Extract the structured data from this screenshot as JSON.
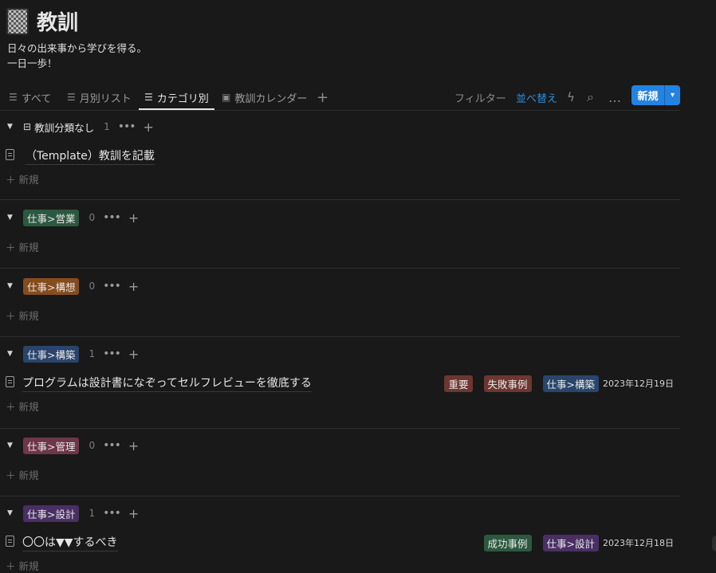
{
  "page": {
    "title": "教訓",
    "desc1": "日々の出来事から学びを得る。",
    "desc2": "一日一歩！"
  },
  "tabs": [
    {
      "label": "すべて",
      "icon": "list-icon"
    },
    {
      "label": "月別リスト",
      "icon": "list-icon"
    },
    {
      "label": "カテゴリ別",
      "icon": "list-icon"
    },
    {
      "label": "教訓カレンダー",
      "icon": "calendar-icon"
    }
  ],
  "toolbar": {
    "add_view": "+",
    "filter": "フィルター",
    "sort": "並べ替え",
    "automation": "ϟ",
    "search": "⌕",
    "more": "…",
    "new": "新規",
    "new_dropdown": "▾"
  },
  "groups": [
    {
      "name": "教訓分類なし",
      "count": "1",
      "rows": [
        {
          "title": "（Template）教訓を記載",
          "tags": [],
          "date": ""
        }
      ]
    },
    {
      "name": "仕事>営業",
      "count": "0",
      "rows": []
    },
    {
      "name": "仕事>構想",
      "count": "0",
      "rows": []
    },
    {
      "name": "仕事>構築",
      "count": "1",
      "rows": [
        {
          "title": "プログラムは設計書になぞってセルフレビューを徹底する",
          "tags": [
            "重要",
            "失敗事例",
            "仕事>構築"
          ],
          "date": "2023年12月19日"
        }
      ]
    },
    {
      "name": "仕事>管理",
      "count": "0",
      "rows": []
    },
    {
      "name": "仕事>設計",
      "count": "1",
      "rows": [
        {
          "title": "〇〇は▼▼するべき",
          "tags": [
            "成功事例",
            "仕事>設計"
          ],
          "date": "2023年12月18日"
        }
      ]
    }
  ],
  "labels": {
    "add_new": "新規",
    "more": "•••",
    "plus": "+"
  },
  "colors": {
    "仕事>営業": "#2b593f",
    "仕事>構想": "#854c1d",
    "仕事>構築": "#28456c",
    "仕事>管理": "#6e3649",
    "仕事>設計": "#492f64",
    "重要": "#6e3630",
    "失敗事例": "#6e3630",
    "成功事例": "#2b593f",
    "accent": "#2383e2"
  }
}
